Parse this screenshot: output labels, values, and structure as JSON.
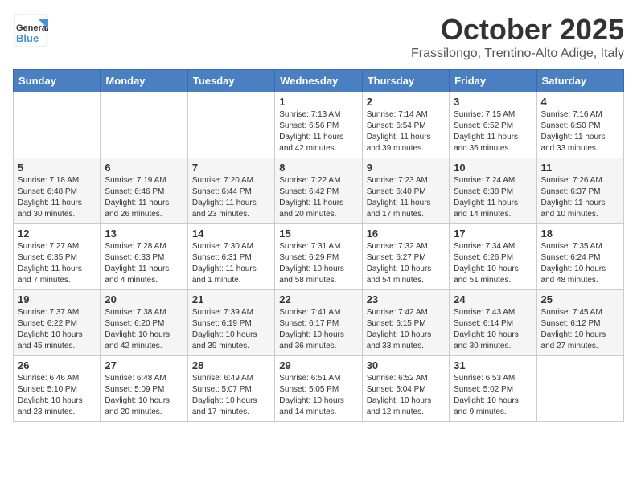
{
  "header": {
    "logo_line1": "General",
    "logo_line2": "Blue",
    "main_title": "October 2025",
    "sub_title": "Frassilongo, Trentino-Alto Adige, Italy"
  },
  "calendar": {
    "days_of_week": [
      "Sunday",
      "Monday",
      "Tuesday",
      "Wednesday",
      "Thursday",
      "Friday",
      "Saturday"
    ],
    "weeks": [
      [
        {
          "day": "",
          "info": ""
        },
        {
          "day": "",
          "info": ""
        },
        {
          "day": "",
          "info": ""
        },
        {
          "day": "1",
          "info": "Sunrise: 7:13 AM\nSunset: 6:56 PM\nDaylight: 11 hours and 42 minutes."
        },
        {
          "day": "2",
          "info": "Sunrise: 7:14 AM\nSunset: 6:54 PM\nDaylight: 11 hours and 39 minutes."
        },
        {
          "day": "3",
          "info": "Sunrise: 7:15 AM\nSunset: 6:52 PM\nDaylight: 11 hours and 36 minutes."
        },
        {
          "day": "4",
          "info": "Sunrise: 7:16 AM\nSunset: 6:50 PM\nDaylight: 11 hours and 33 minutes."
        }
      ],
      [
        {
          "day": "5",
          "info": "Sunrise: 7:18 AM\nSunset: 6:48 PM\nDaylight: 11 hours and 30 minutes."
        },
        {
          "day": "6",
          "info": "Sunrise: 7:19 AM\nSunset: 6:46 PM\nDaylight: 11 hours and 26 minutes."
        },
        {
          "day": "7",
          "info": "Sunrise: 7:20 AM\nSunset: 6:44 PM\nDaylight: 11 hours and 23 minutes."
        },
        {
          "day": "8",
          "info": "Sunrise: 7:22 AM\nSunset: 6:42 PM\nDaylight: 11 hours and 20 minutes."
        },
        {
          "day": "9",
          "info": "Sunrise: 7:23 AM\nSunset: 6:40 PM\nDaylight: 11 hours and 17 minutes."
        },
        {
          "day": "10",
          "info": "Sunrise: 7:24 AM\nSunset: 6:38 PM\nDaylight: 11 hours and 14 minutes."
        },
        {
          "day": "11",
          "info": "Sunrise: 7:26 AM\nSunset: 6:37 PM\nDaylight: 11 hours and 10 minutes."
        }
      ],
      [
        {
          "day": "12",
          "info": "Sunrise: 7:27 AM\nSunset: 6:35 PM\nDaylight: 11 hours and 7 minutes."
        },
        {
          "day": "13",
          "info": "Sunrise: 7:28 AM\nSunset: 6:33 PM\nDaylight: 11 hours and 4 minutes."
        },
        {
          "day": "14",
          "info": "Sunrise: 7:30 AM\nSunset: 6:31 PM\nDaylight: 11 hours and 1 minute."
        },
        {
          "day": "15",
          "info": "Sunrise: 7:31 AM\nSunset: 6:29 PM\nDaylight: 10 hours and 58 minutes."
        },
        {
          "day": "16",
          "info": "Sunrise: 7:32 AM\nSunset: 6:27 PM\nDaylight: 10 hours and 54 minutes."
        },
        {
          "day": "17",
          "info": "Sunrise: 7:34 AM\nSunset: 6:26 PM\nDaylight: 10 hours and 51 minutes."
        },
        {
          "day": "18",
          "info": "Sunrise: 7:35 AM\nSunset: 6:24 PM\nDaylight: 10 hours and 48 minutes."
        }
      ],
      [
        {
          "day": "19",
          "info": "Sunrise: 7:37 AM\nSunset: 6:22 PM\nDaylight: 10 hours and 45 minutes."
        },
        {
          "day": "20",
          "info": "Sunrise: 7:38 AM\nSunset: 6:20 PM\nDaylight: 10 hours and 42 minutes."
        },
        {
          "day": "21",
          "info": "Sunrise: 7:39 AM\nSunset: 6:19 PM\nDaylight: 10 hours and 39 minutes."
        },
        {
          "day": "22",
          "info": "Sunrise: 7:41 AM\nSunset: 6:17 PM\nDaylight: 10 hours and 36 minutes."
        },
        {
          "day": "23",
          "info": "Sunrise: 7:42 AM\nSunset: 6:15 PM\nDaylight: 10 hours and 33 minutes."
        },
        {
          "day": "24",
          "info": "Sunrise: 7:43 AM\nSunset: 6:14 PM\nDaylight: 10 hours and 30 minutes."
        },
        {
          "day": "25",
          "info": "Sunrise: 7:45 AM\nSunset: 6:12 PM\nDaylight: 10 hours and 27 minutes."
        }
      ],
      [
        {
          "day": "26",
          "info": "Sunrise: 6:46 AM\nSunset: 5:10 PM\nDaylight: 10 hours and 23 minutes."
        },
        {
          "day": "27",
          "info": "Sunrise: 6:48 AM\nSunset: 5:09 PM\nDaylight: 10 hours and 20 minutes."
        },
        {
          "day": "28",
          "info": "Sunrise: 6:49 AM\nSunset: 5:07 PM\nDaylight: 10 hours and 17 minutes."
        },
        {
          "day": "29",
          "info": "Sunrise: 6:51 AM\nSunset: 5:05 PM\nDaylight: 10 hours and 14 minutes."
        },
        {
          "day": "30",
          "info": "Sunrise: 6:52 AM\nSunset: 5:04 PM\nDaylight: 10 hours and 12 minutes."
        },
        {
          "day": "31",
          "info": "Sunrise: 6:53 AM\nSunset: 5:02 PM\nDaylight: 10 hours and 9 minutes."
        },
        {
          "day": "",
          "info": ""
        }
      ]
    ]
  }
}
